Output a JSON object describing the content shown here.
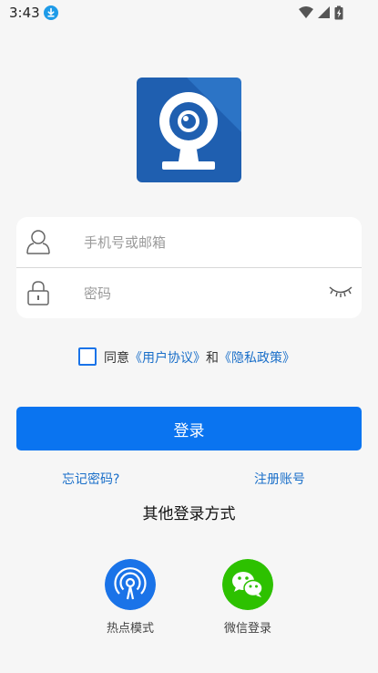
{
  "status_bar": {
    "time": "3:43",
    "icons": [
      "download-icon",
      "wifi-icon",
      "signal-icon",
      "battery-icon"
    ]
  },
  "logo": {
    "icon": "webcam-logo"
  },
  "login_form": {
    "account_placeholder": "手机号或邮箱",
    "account_value": "",
    "password_placeholder": "密码",
    "password_value": "",
    "account_icon": "user-icon",
    "password_icon": "lock-icon",
    "visibility_icon": "eye-closed-icon"
  },
  "agreement": {
    "prefix": "同意",
    "terms": "《用户协议》",
    "conjunction": "和",
    "privacy": "《隐私政策》",
    "checked": false
  },
  "login_button": "登录",
  "forgot_password": "忘记密码?",
  "register": "注册账号",
  "other_login": {
    "title": "其他登录方式",
    "options": [
      {
        "label": "热点模式",
        "icon": "hotspot-icon",
        "color": "#1a73e8"
      },
      {
        "label": "微信登录",
        "icon": "wechat-icon",
        "color": "#2dc100"
      }
    ]
  },
  "colors": {
    "primary": "#0a74f0",
    "link": "#1a6fc9",
    "background": "#f6f6f6"
  }
}
